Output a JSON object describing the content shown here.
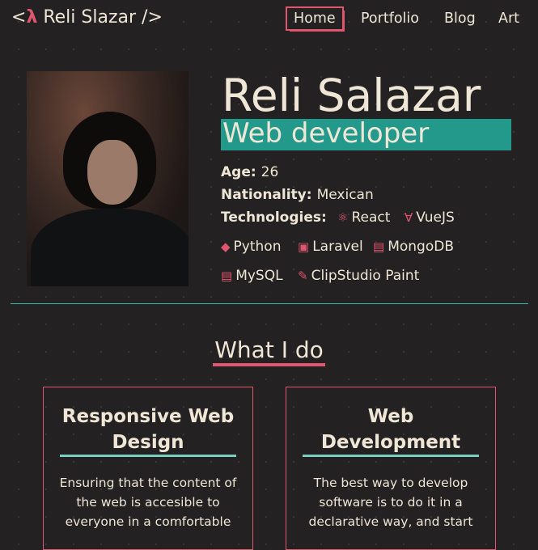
{
  "header": {
    "logo_open": "<",
    "logo_lambda": "λ",
    "logo_name": " Reli Slazar />",
    "nav": [
      {
        "label": "Home",
        "active": true
      },
      {
        "label": "Portfolio",
        "active": false
      },
      {
        "label": "Blog",
        "active": false
      },
      {
        "label": "Art",
        "active": false
      }
    ]
  },
  "profile": {
    "name": "Reli Salazar",
    "role": "Web developer",
    "age_label": "Age:",
    "age_value": "26",
    "nationality_label": "Nationality:",
    "nationality_value": "Mexican",
    "technologies_label": "Technologies:",
    "technologies": [
      {
        "label": "React",
        "icon": "react-icon"
      },
      {
        "label": "VueJS",
        "icon": "vue-icon"
      },
      {
        "label": "Python",
        "icon": "python-icon"
      },
      {
        "label": "Laravel",
        "icon": "laravel-icon"
      },
      {
        "label": "MongoDB",
        "icon": "database-icon"
      },
      {
        "label": "MySQL",
        "icon": "database-icon"
      },
      {
        "label": "ClipStudio Paint",
        "icon": "brush-icon"
      }
    ]
  },
  "what_i_do": {
    "title": "What I do",
    "cards": [
      {
        "title": "Responsive Web Design",
        "text": "Ensuring that the content of the web is accesible to everyone in a comfortable"
      },
      {
        "title": "Web Development",
        "text": "The best way to develop software is to do it in a declarative way, and start"
      }
    ]
  },
  "colors": {
    "accent": "#e0566e",
    "teal": "#23998c",
    "background": "#232122",
    "text": "#efe6d6"
  }
}
